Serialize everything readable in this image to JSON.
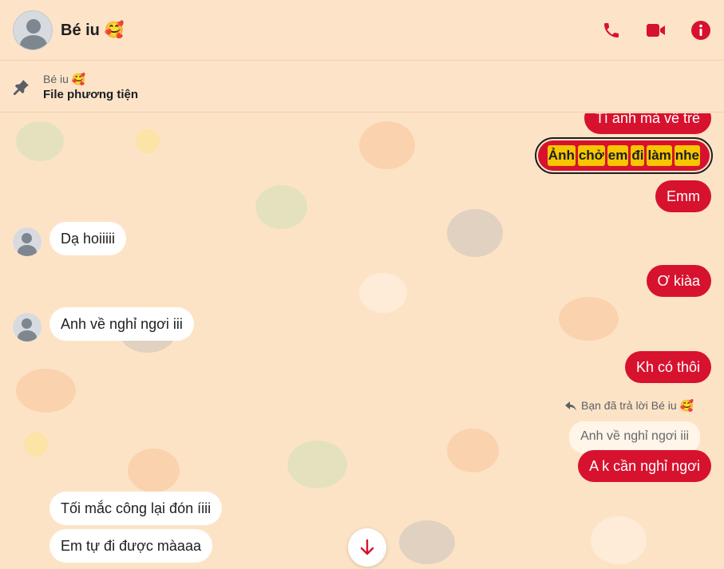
{
  "header": {
    "contact_name": "Bé iu 🥰",
    "icons": [
      "avatar",
      "phone-icon",
      "video-call-icon",
      "info-icon"
    ]
  },
  "pinned": {
    "sender": "Bé iu 🥰",
    "title": "File phương tiện",
    "icon": "pin-icon"
  },
  "messages": {
    "m1": "Tí anh mà về trễ",
    "m2_words": [
      "Ảnh",
      "chở",
      "em",
      "đi",
      "làm",
      "nhe"
    ],
    "m3": "Emm",
    "m4": "Dạ hoiiiii",
    "m5": "Ơ kiàa",
    "m6": "Anh về nghỉ ngơi iii",
    "m7": "Kh có thôi",
    "reply_note": "Bạn đã trả lời Bé iu 🥰",
    "quoted": "Anh về nghỉ ngơi iii",
    "m8": "A k cần nghỉ ngơi",
    "m9": "Tối mắc công lại đón íiii",
    "m10": "Em tự đi được màaaa"
  },
  "colors": {
    "outgoing_bubble": "#d7122e",
    "incoming_bubble": "#ffffff",
    "background": "#fde3c6",
    "highlight": "#f7c600",
    "accent": "#d7122e"
  }
}
